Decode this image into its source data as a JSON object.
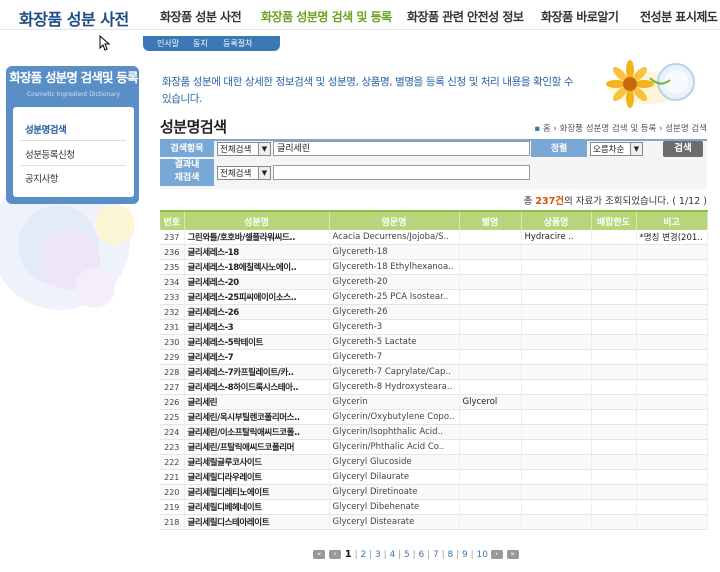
{
  "site": {
    "title": "화장품 성분 사전"
  },
  "gnb": [
    {
      "label": "화장품 성분 사전",
      "active": false
    },
    {
      "label": "화장품 성분명 검색 및 등록",
      "active": true
    },
    {
      "label": "화장품 관련 안전성 정보",
      "active": false
    },
    {
      "label": "화장품 바로알기",
      "active": false
    },
    {
      "label": "전성분 표시제도",
      "active": false
    }
  ],
  "subnav": [
    "인사말",
    "동치",
    "등록절차"
  ],
  "sidebar": {
    "title": "화장품 성분명 검색및 등록",
    "subtitle": "Cosmetic Ingredient Dictionary",
    "items": [
      {
        "label": "성분명검색",
        "active": true
      },
      {
        "label": "성분등록신청",
        "active": false
      },
      {
        "label": "공지사항",
        "active": false
      }
    ]
  },
  "intro": {
    "text": "화장품 성분에 대한 상세한 정보검색 및 성분명, 상품명, 별명을 등록 신청 및 처리 내용을 확인할 수 있습니다."
  },
  "page": {
    "title": "성분명검색",
    "breadcrumb": [
      "홈",
      "화장품 성분명 검색 및 등록",
      "성분명 검색"
    ]
  },
  "search": {
    "label_item": "검색항목",
    "field_select": "전체검색",
    "query": "글리세린",
    "label_sort": "정렬",
    "sort_select": "오름차순",
    "button": "검색",
    "label_refine_1": "결과내",
    "label_refine_2": "재검색",
    "refine_select": "전체검색",
    "refine_query": ""
  },
  "results": {
    "prefix": "총 ",
    "count": "237건",
    "suffix": "의 자료가 조회되었습니다. ( 1/12 )",
    "columns": [
      "번호",
      "성분명",
      "영문명",
      "별명",
      "상품명",
      "배합한도",
      "비고"
    ],
    "rows": [
      [
        "237",
        "그린와틀/호호바/셀플라워씨드..",
        "Acacia Decurrens/Jojoba/S..",
        "",
        "Hydracire ..",
        "",
        "*명칭 변경(201.."
      ],
      [
        "236",
        "글리세레스-18",
        "Glycereth-18",
        "",
        "",
        "",
        ""
      ],
      [
        "235",
        "글리세레스-18에칠렉사노에이..",
        "Glycereth-18 Ethylhexanoa..",
        "",
        "",
        "",
        ""
      ],
      [
        "234",
        "글리세레스-20",
        "Glycereth-20",
        "",
        "",
        "",
        ""
      ],
      [
        "233",
        "글리세레스-25피씨에이이소스..",
        "Glycereth-25 PCA Isostear..",
        "",
        "",
        "",
        ""
      ],
      [
        "232",
        "글리세레스-26",
        "Glycereth-26",
        "",
        "",
        "",
        ""
      ],
      [
        "231",
        "글리세레스-3",
        "Glycereth-3",
        "",
        "",
        "",
        ""
      ],
      [
        "230",
        "글리세레스-5락테이트",
        "Glycereth-5 Lactate",
        "",
        "",
        "",
        ""
      ],
      [
        "229",
        "글리세레스-7",
        "Glycereth-7",
        "",
        "",
        "",
        ""
      ],
      [
        "228",
        "글리세레스-7카프릴레이트/카..",
        "Glycereth-7 Caprylate/Cap..",
        "",
        "",
        "",
        ""
      ],
      [
        "227",
        "글리세레스-8하이드록시스테아..",
        "Glycereth-8 Hydroxystearа..",
        "",
        "",
        "",
        ""
      ],
      [
        "226",
        "글리세린",
        "Glycerin",
        "Glycerol",
        "",
        "",
        ""
      ],
      [
        "225",
        "글리세린/옥시부틸렌코폴리머스..",
        "Glycerin/Oxybutylene Copo..",
        "",
        "",
        "",
        ""
      ],
      [
        "224",
        "글리세린/이소프탈릭애씨드코폴..",
        "Glycerin/Isophthalic Acid..",
        "",
        "",
        "",
        ""
      ],
      [
        "223",
        "글리세린/프탈릭애씨드코폴리머",
        "Glycerin/Phthalic Acid Co..",
        "",
        "",
        "",
        ""
      ],
      [
        "222",
        "글리세릴글루코사이드",
        "Glyceryl Glucoside",
        "",
        "",
        "",
        ""
      ],
      [
        "221",
        "글리세릴디라우레이트",
        "Glyceryl Dilaurate",
        "",
        "",
        "",
        ""
      ],
      [
        "220",
        "글리세릴디레티노에이트",
        "Glyceryl Diretinoate",
        "",
        "",
        "",
        ""
      ],
      [
        "219",
        "글리세릴디베헤네이트",
        "Glyceryl Dibehenate",
        "",
        "",
        "",
        ""
      ],
      [
        "218",
        "글리세릴디스테아레이트",
        "Glyceryl Distearate",
        "",
        "",
        "",
        ""
      ]
    ]
  },
  "pagination": {
    "first": "«",
    "prev": "‹",
    "pages": [
      "1",
      "2",
      "3",
      "4",
      "5",
      "6",
      "7",
      "8",
      "9",
      "10"
    ],
    "current": "1",
    "next": "›",
    "last": "»"
  },
  "colors": {
    "brand_blue": "#1d4d80",
    "nav_active_green": "#6aa321",
    "table_header_green": "#b5d67a",
    "form_label_blue": "#7aa8d6",
    "count_orange": "#d35400"
  }
}
